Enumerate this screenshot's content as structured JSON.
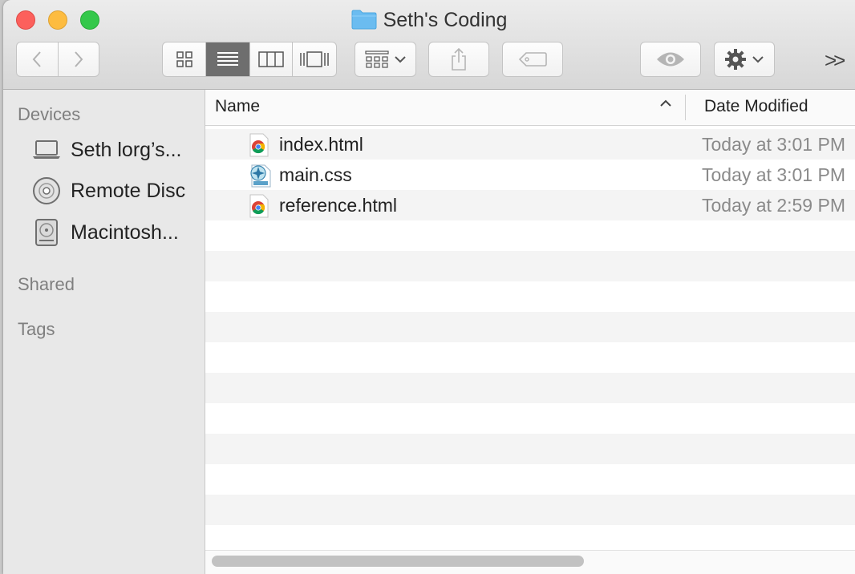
{
  "window": {
    "title": "Seth's Coding"
  },
  "toolbar": {
    "back": "chevron-left-icon",
    "forward": "chevron-right-icon",
    "view_modes": [
      "icon-view",
      "list-view",
      "column-view",
      "coverflow-view"
    ],
    "active_view": "list-view",
    "arrange": "arrange-icon",
    "share": "share-icon",
    "tags": "tag-icon",
    "quicklook": "eye-icon",
    "action": "gear-icon",
    "overflow_label": ">>"
  },
  "sidebar": {
    "devices_header": "Devices",
    "devices": [
      {
        "label": "Seth lorg’s...",
        "icon": "laptop-icon"
      },
      {
        "label": "Remote Disc",
        "icon": "disc-icon"
      },
      {
        "label": "Macintosh...",
        "icon": "hard-drive-icon"
      }
    ],
    "shared_header": "Shared",
    "tags_header": "Tags"
  },
  "columns": {
    "name": "Name",
    "date_modified": "Date Modified",
    "sort": "ascending"
  },
  "files": [
    {
      "name": "index.html",
      "date": "Today at 3:01 PM",
      "icon": "chrome-document-icon"
    },
    {
      "name": "main.css",
      "date": "Today at 3:01 PM",
      "icon": "css-document-icon"
    },
    {
      "name": "reference.html",
      "date": "Today at 2:59 PM",
      "icon": "chrome-document-icon"
    }
  ],
  "colors": {
    "close": "#fc605c",
    "minimize": "#fdbc40",
    "maximize": "#34c84a",
    "folder": "#6bbcf0"
  }
}
